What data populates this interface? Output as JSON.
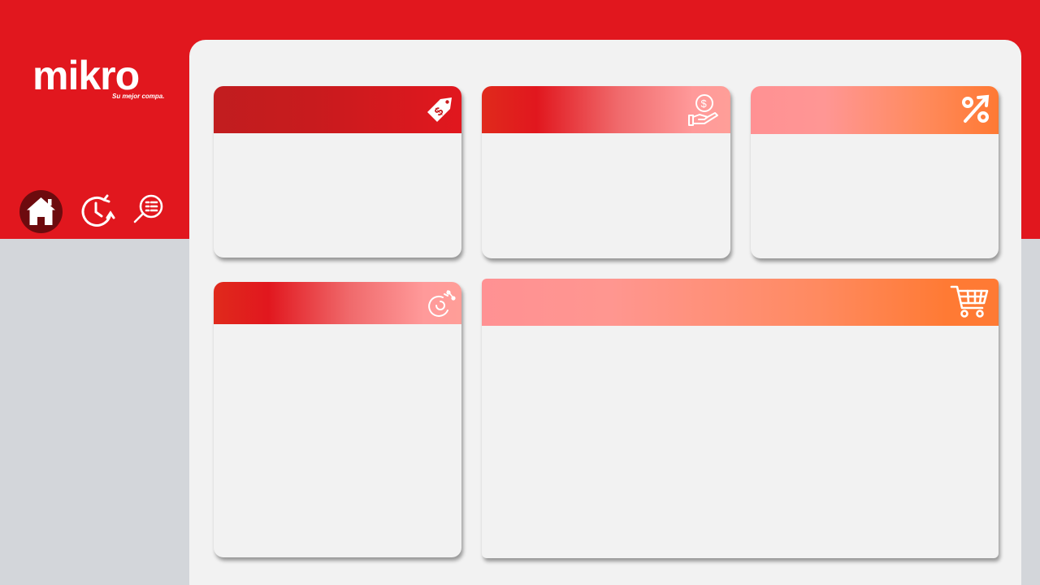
{
  "brand": {
    "name": "mikro",
    "tagline": "Su mejor compa.",
    "primary_color": "#e1171e",
    "dark_accent": "#6d0b0e"
  },
  "nav": {
    "items": [
      {
        "id": "home",
        "icon": "home-icon",
        "active": true
      },
      {
        "id": "history",
        "icon": "history-clock-icon",
        "active": false
      },
      {
        "id": "search",
        "icon": "search-report-icon",
        "active": false
      }
    ]
  },
  "cards": [
    {
      "id": "card1",
      "icon": "price-tag-icon",
      "title": "",
      "content": ""
    },
    {
      "id": "card2",
      "icon": "money-hand-icon",
      "title": "",
      "content": ""
    },
    {
      "id": "card3",
      "icon": "percent-up-icon",
      "title": "",
      "content": ""
    },
    {
      "id": "card4",
      "icon": "discount-pie-icon",
      "title": "",
      "content": ""
    },
    {
      "id": "card5",
      "icon": "shopping-cart-icon",
      "title": "",
      "content": ""
    }
  ],
  "colors": {
    "page_bg": "#d3d6da",
    "panel_bg": "#f2f2f2",
    "header_red": "#e1171e",
    "header_pink": "#ff9193",
    "header_orange": "#ff7933"
  }
}
